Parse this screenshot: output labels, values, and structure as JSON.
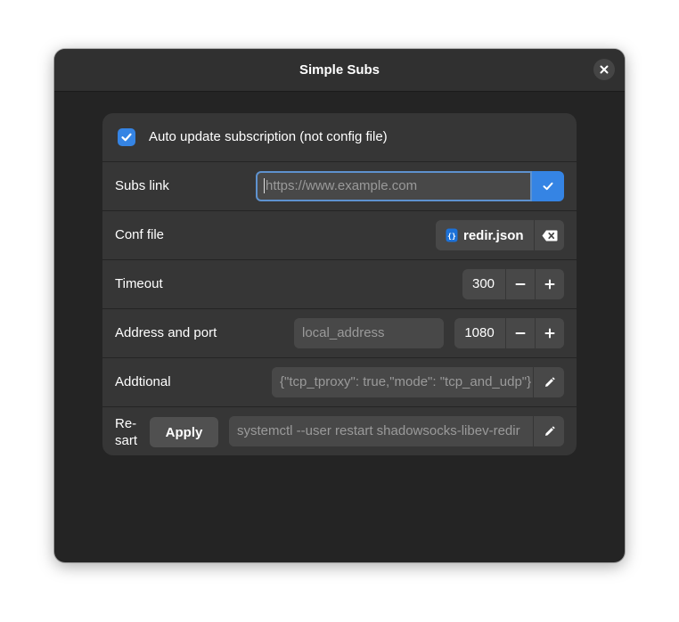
{
  "window": {
    "title": "Simple Subs"
  },
  "auto_update": {
    "checked": true,
    "label": "Auto update subscription (not config file)"
  },
  "subs_link": {
    "label": "Subs link",
    "placeholder": "https://www.example.com",
    "value": ""
  },
  "conf_file": {
    "label": "Conf file",
    "filename": "redir.json",
    "icon": "json-file-icon"
  },
  "timeout": {
    "label": "Timeout",
    "value": "300"
  },
  "address": {
    "label": "Address and port",
    "address_placeholder": "local_address",
    "port": "1080"
  },
  "additional": {
    "label": "Addtional",
    "value": "{\"tcp_tproxy\": true,\"mode\": \"tcp_and_udp\"}"
  },
  "restart": {
    "label_line1": "Re-",
    "label_line2": "sart",
    "apply_label": "Apply",
    "command": "systemctl --user restart shadowsocks-libev-redir"
  },
  "colors": {
    "accent": "#3584e4",
    "window_bg": "#242424",
    "card_bg": "#363636"
  }
}
